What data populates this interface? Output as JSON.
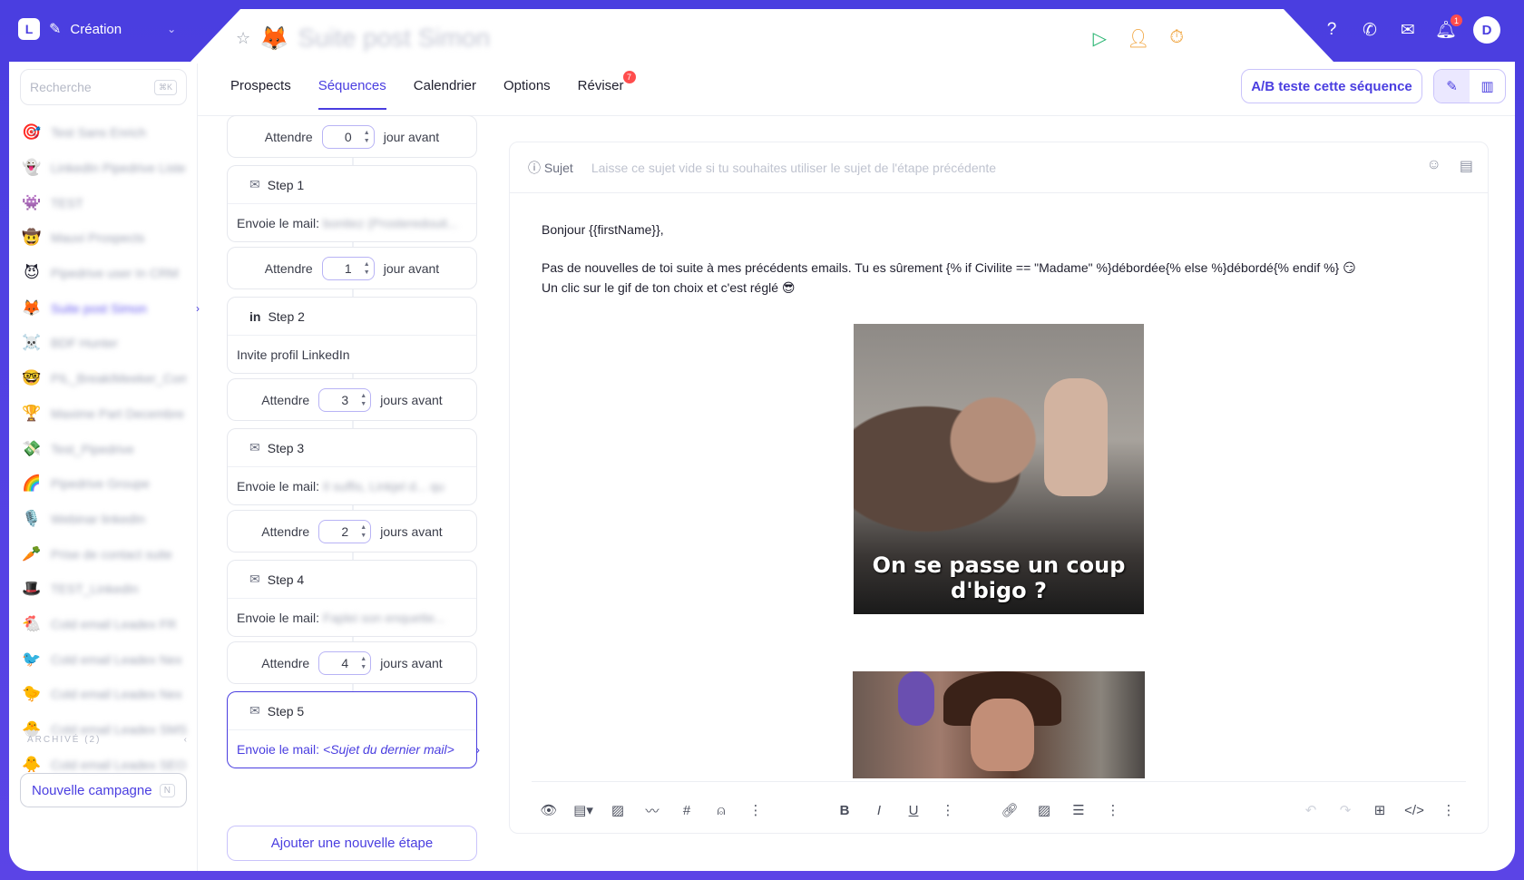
{
  "app": {
    "workspace_label": "Création",
    "logo_letter": "L",
    "avatar_letter": "D",
    "notif_count": "1"
  },
  "sequence": {
    "title": "Suite post Simon",
    "emoji": "🦊"
  },
  "sidebar": {
    "search_placeholder": "Recherche",
    "search_shortcut": "⌘K",
    "campaigns": [
      {
        "emoji": "🎯",
        "name": "Test Sans Enrich"
      },
      {
        "emoji": "👻",
        "name": "LinkedIn Pipedrive Liste"
      },
      {
        "emoji": "👾",
        "name": "TEST"
      },
      {
        "emoji": "🤠",
        "name": "Mauvi Prospects"
      },
      {
        "emoji": "😈",
        "name": "Pipedrive user In CRM"
      },
      {
        "emoji": "🦊",
        "name": "Suite post Simon",
        "active": true
      },
      {
        "emoji": "☠️",
        "name": "BDF Hunter"
      },
      {
        "emoji": "🤓",
        "name": "PIL_BreakIMeeker_Com"
      },
      {
        "emoji": "🏆",
        "name": "Maxime Part Decembre"
      },
      {
        "emoji": "💸",
        "name": "Test_Pipedrive"
      },
      {
        "emoji": "🌈",
        "name": "Pipedrive Groupe"
      },
      {
        "emoji": "🎙️",
        "name": "Webinar linkedIn"
      },
      {
        "emoji": "🥕",
        "name": "Prise de contact suite"
      },
      {
        "emoji": "🎩",
        "name": "TEST_LinkedIn"
      },
      {
        "emoji": "🐔",
        "name": "Cold email Leadex FR"
      },
      {
        "emoji": "🐦",
        "name": "Cold email Leadex Nex"
      },
      {
        "emoji": "🐤",
        "name": "Cold email Leadex Nex"
      },
      {
        "emoji": "🐣",
        "name": "Cold email Leadex SMS"
      },
      {
        "emoji": "🐥",
        "name": "Cold email Leadex SEO"
      }
    ],
    "archive_label": "ARCHIVÉ (2)",
    "new_campaign": "Nouvelle campagne",
    "new_campaign_shortcut": "N"
  },
  "tabs": [
    {
      "label": "Prospects"
    },
    {
      "label": "Séquences",
      "active": true
    },
    {
      "label": "Calendrier"
    },
    {
      "label": "Options"
    },
    {
      "label": "Réviser",
      "badge": "7"
    }
  ],
  "ab_button": "A/B teste cette séquence",
  "steps": {
    "waits": [
      {
        "label": "Attendre",
        "value": "0",
        "suffix": "jour avant"
      },
      {
        "label": "Attendre",
        "value": "1",
        "suffix": "jour avant"
      },
      {
        "label": "Attendre",
        "value": "3",
        "suffix": "jours avant"
      },
      {
        "label": "Attendre",
        "value": "2",
        "suffix": "jours avant"
      },
      {
        "label": "Attendre",
        "value": "4",
        "suffix": "jours avant"
      }
    ],
    "items": [
      {
        "title": "Step 1",
        "action": "Envoie le mail:",
        "detail": "bonitez (Prosteredouit..."
      },
      {
        "title": "Step 2",
        "action": "Invite profil LinkedIn",
        "detail": ""
      },
      {
        "title": "Step 3",
        "action": "Envoie le mail:",
        "detail": "Il suffis, Linkjel d... qu"
      },
      {
        "title": "Step 4",
        "action": "Envoie le mail:",
        "detail": "Faplei son enquette..."
      },
      {
        "title": "Step 5",
        "action": "Envoie le mail:",
        "detail": "<Sujet du dernier mail>"
      }
    ],
    "add_step": "Ajouter une nouvelle étape"
  },
  "editor": {
    "subject_label": "Sujet",
    "subject_placeholder": "Laisse ce sujet vide si tu souhaites utiliser le sujet de l'étape précédente",
    "greeting": "Bonjour {{firstName}},",
    "line1": "Pas de nouvelles de toi suite à mes précédents emails. Tu es sûrement {% if Civilite == \"Madame\" %}débordée{% else %}débordé{% endif %} 😏",
    "line2": "Un clic sur le gif de ton choix et c'est réglé 😎",
    "gif1_caption": "On se passe un coup d'bigo ?"
  }
}
